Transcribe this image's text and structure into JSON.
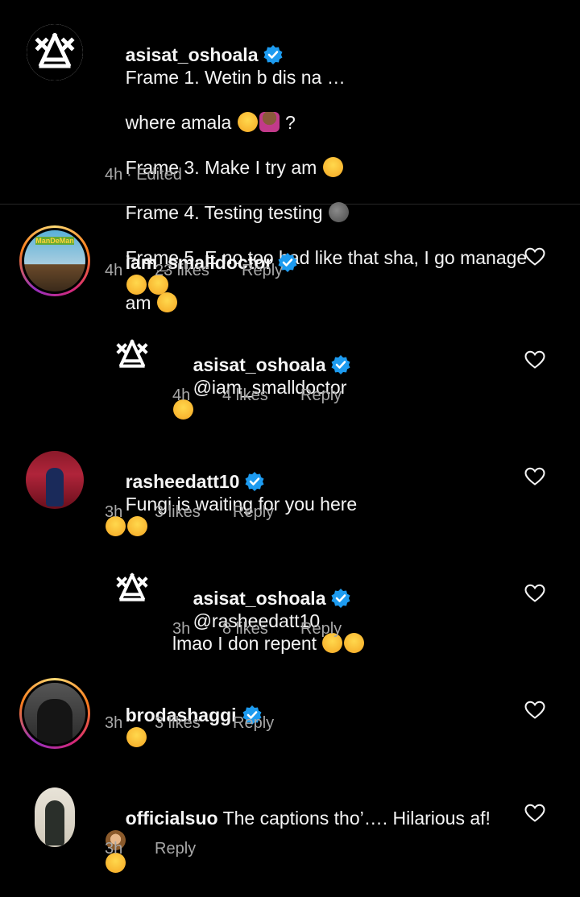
{
  "caption": {
    "username": "asisat_oshoala",
    "lines": [
      "Frame 1. Wetin b dis na …",
      "where amala",
      " ?",
      "Frame 3. Make I try am ",
      "Frame 4. Testing testing ",
      "Frame 5. E no too bad like that sha, I go manage",
      "am "
    ],
    "time": "4h",
    "edited": "· Edited"
  },
  "comments": [
    {
      "username": "iam_smalldoctor",
      "text": "",
      "time": "4h",
      "likes": "23 likes",
      "reply": "Reply",
      "avatar_label": "ManDeMan"
    },
    {
      "username": "asisat_oshoala",
      "text": "@iam_smalldoctor",
      "time": "4h",
      "likes": "4 likes",
      "reply": "Reply"
    },
    {
      "username": "rasheedatt10",
      "text": "Fungi is waiting for you here",
      "time": "3h",
      "likes": "3 likes",
      "reply": "Reply"
    },
    {
      "username": "asisat_oshoala",
      "text": "@rasheedatt10",
      "text2": "lmao I don repent ",
      "time": "3h",
      "likes": "8 likes",
      "reply": "Reply"
    },
    {
      "username": "brodashaggi",
      "text": "",
      "time": "3h",
      "likes": "3 likes",
      "reply": "Reply"
    },
    {
      "username": "officialsuo",
      "text": "The captions tho’…. Hilarious af!",
      "time": "3h",
      "reply": "Reply"
    }
  ],
  "icons": {
    "verified": "verified-badge-icon",
    "heart": "heart-outline-icon"
  },
  "colors": {
    "background": "#000000",
    "text": "#f5f5f5",
    "secondary": "#a8a8a8",
    "verified": "#1d9bf0"
  }
}
